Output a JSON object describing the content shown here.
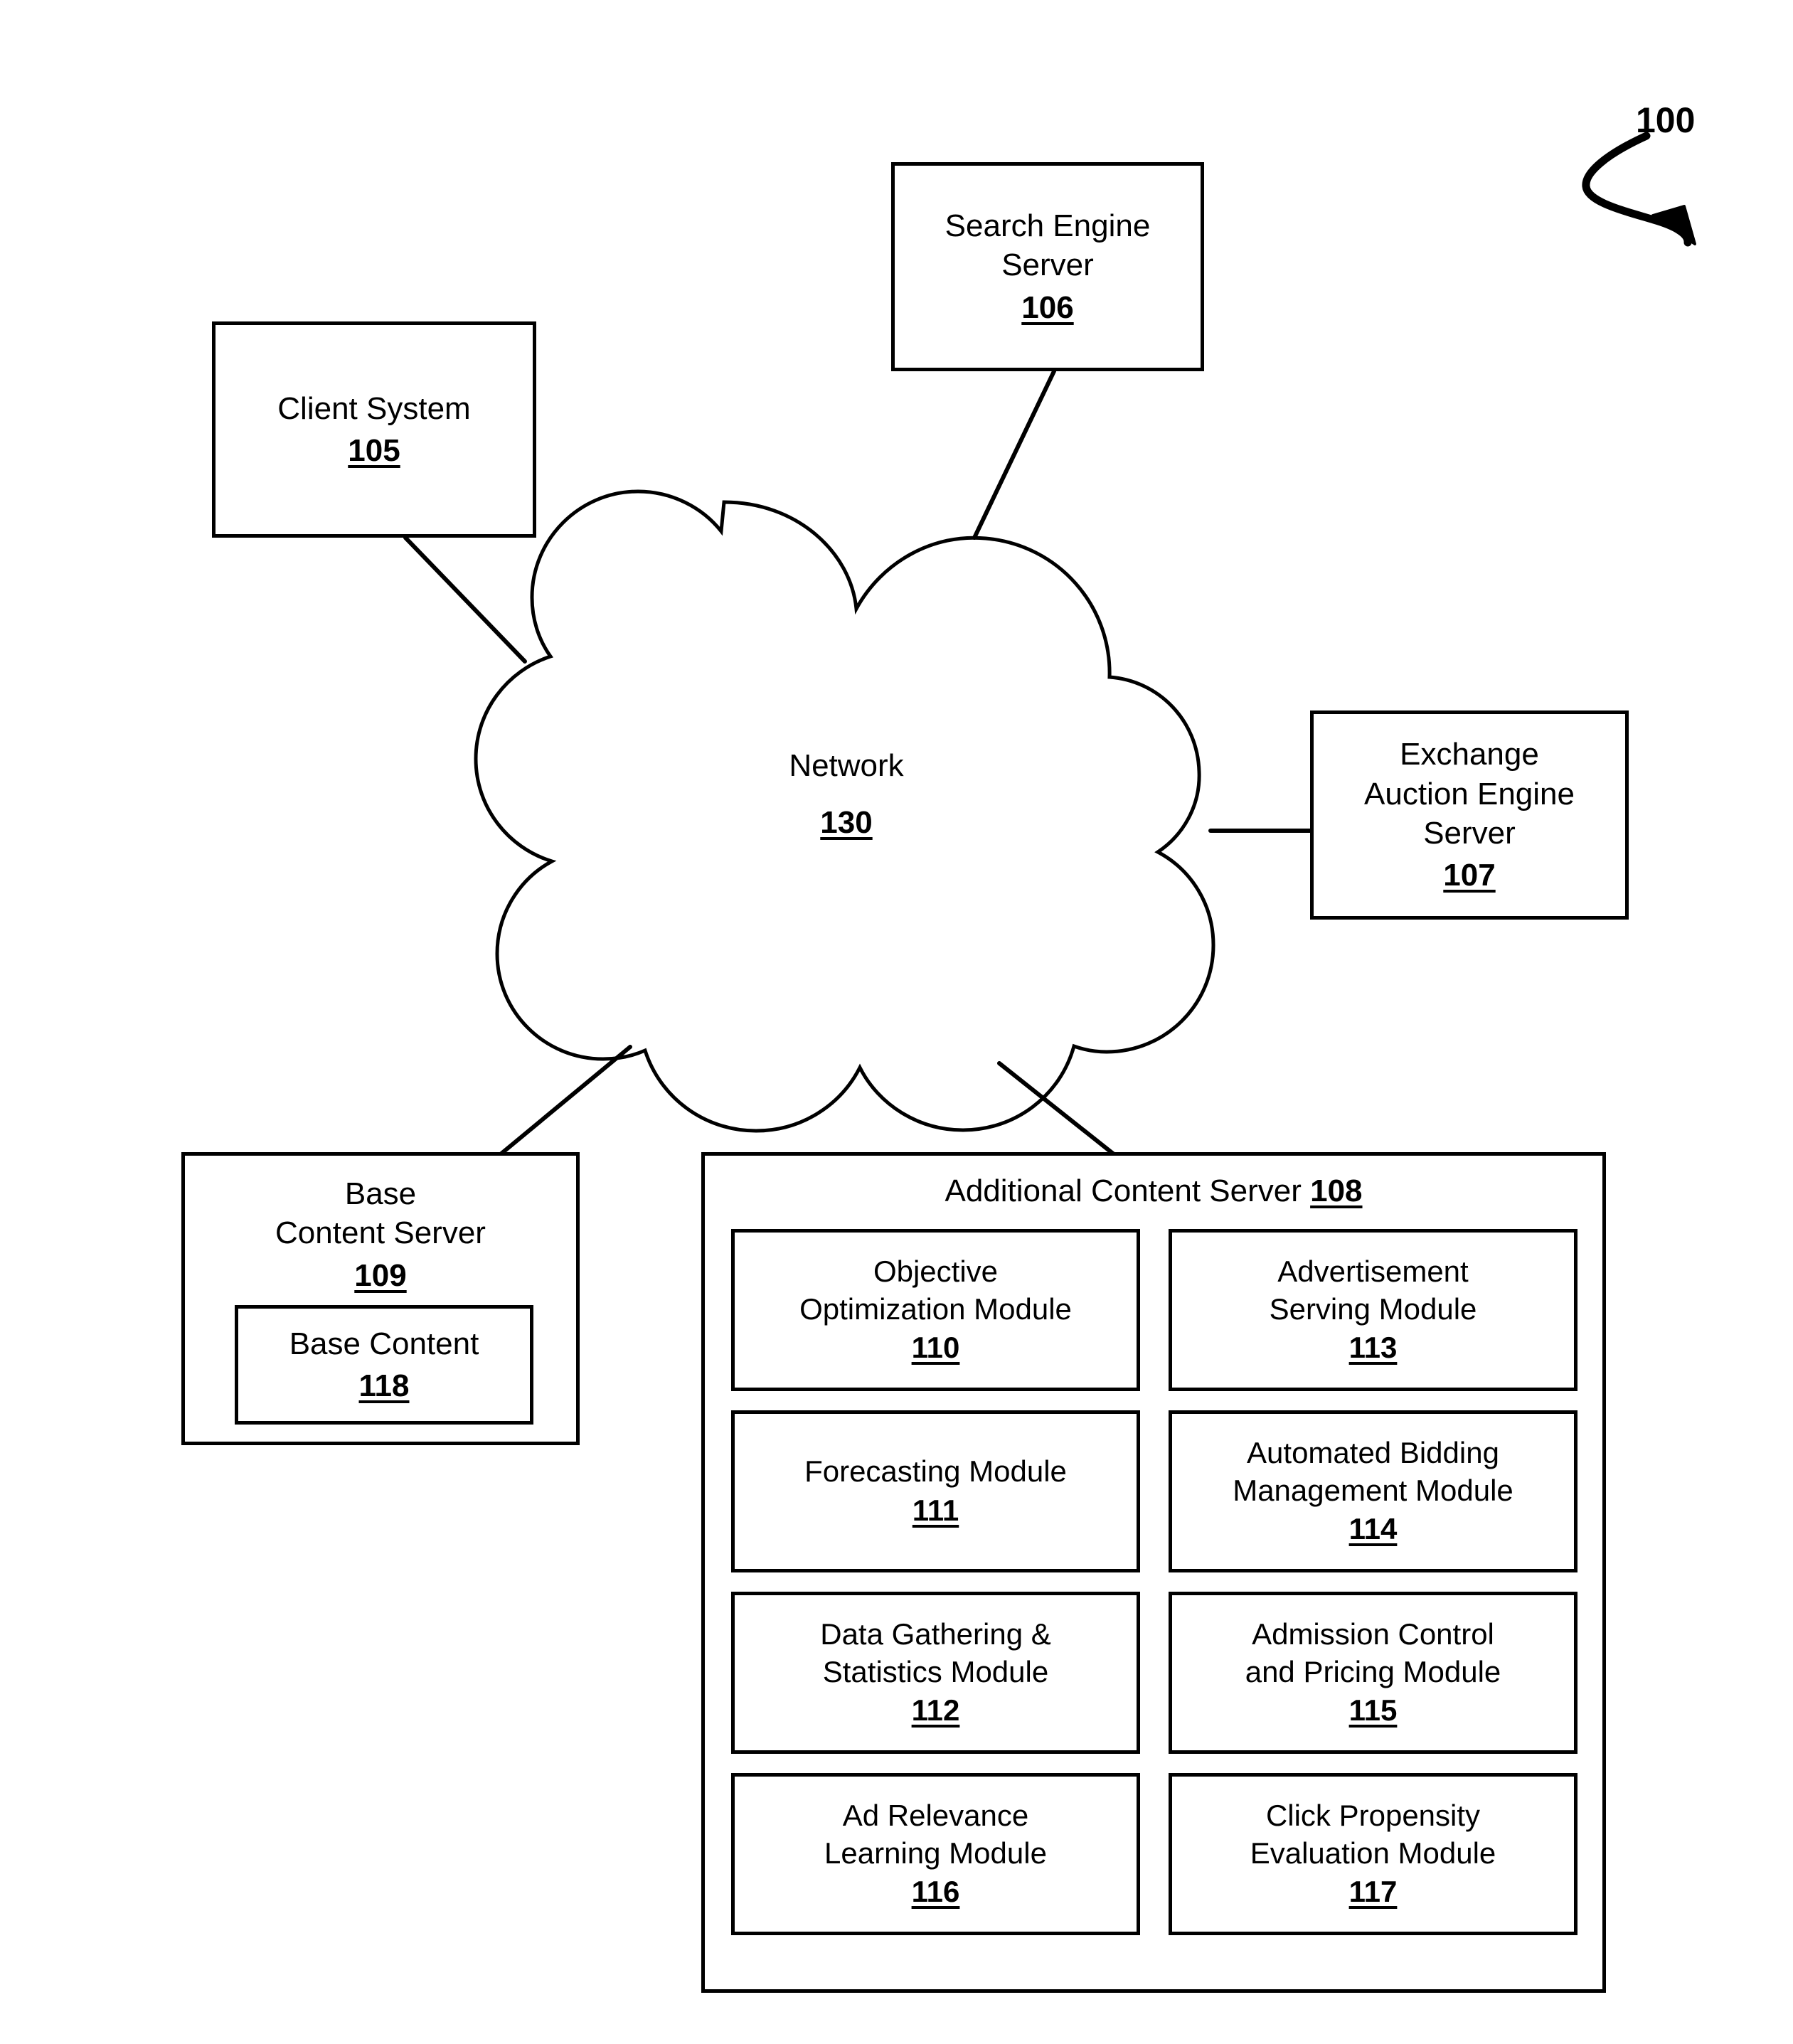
{
  "figure": {
    "reference_numeral": "100",
    "pointer_icon": "curved-arrow-icon"
  },
  "nodes": {
    "client_system": {
      "title": "Client System",
      "ref": "105"
    },
    "search_engine_server": {
      "title": "Search Engine\nServer",
      "ref": "106"
    },
    "exchange_auction_engine_server": {
      "title": "Exchange\nAuction Engine\nServer",
      "ref": "107"
    },
    "network": {
      "title": "Network",
      "ref": "130",
      "shape": "cloud-icon"
    },
    "base_content_server": {
      "title": "Base\nContent Server",
      "ref": "109"
    },
    "base_content": {
      "title": "Base Content",
      "ref": "118"
    }
  },
  "additional_content_server": {
    "header_label": "Additional Content Server",
    "header_ref": "108",
    "modules": [
      {
        "title": "Objective\nOptimization Module",
        "ref": "110"
      },
      {
        "title": "Advertisement\nServing Module",
        "ref": "113"
      },
      {
        "title": "Forecasting Module",
        "ref": "111"
      },
      {
        "title": "Automated Bidding\nManagement Module",
        "ref": "114"
      },
      {
        "title": "Data Gathering &\nStatistics Module",
        "ref": "112"
      },
      {
        "title": "Admission Control\nand Pricing Module",
        "ref": "115"
      },
      {
        "title": "Ad Relevance\nLearning Module",
        "ref": "116"
      },
      {
        "title": "Click Propensity\nEvaluation Module",
        "ref": "117"
      }
    ]
  },
  "connectors": [
    {
      "name": "client-system-to-network",
      "from": "client_system",
      "to": "network"
    },
    {
      "name": "search-engine-server-to-network",
      "from": "search_engine_server",
      "to": "network"
    },
    {
      "name": "network-to-exchange-auction-engine-server",
      "from": "network",
      "to": "exchange_auction_engine_server"
    },
    {
      "name": "network-to-base-content-server",
      "from": "network",
      "to": "base_content_server"
    },
    {
      "name": "network-to-additional-content-server",
      "from": "network",
      "to": "additional_content_server"
    }
  ],
  "colors": {
    "stroke": "#000000",
    "background": "#ffffff"
  }
}
